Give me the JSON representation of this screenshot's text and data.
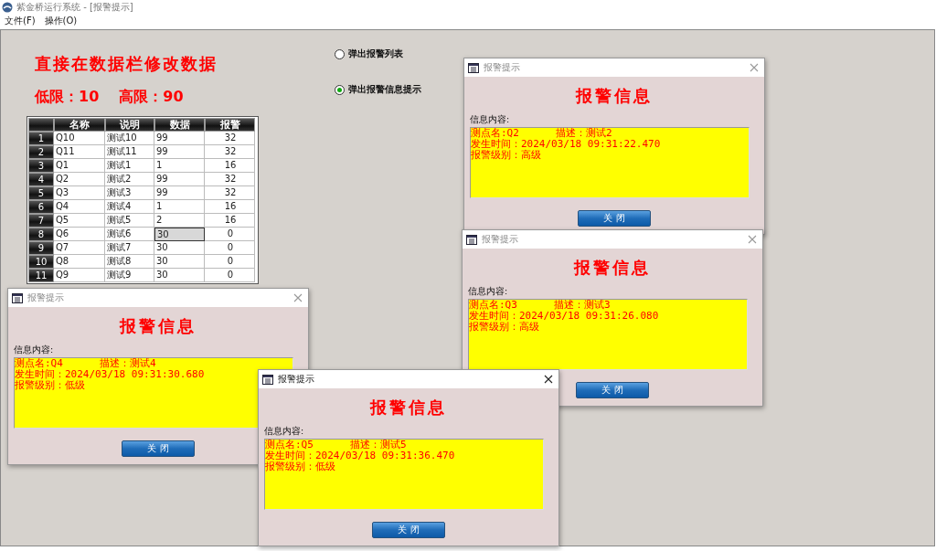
{
  "window": {
    "title": "紫金桥运行系统 - [报警提示]"
  },
  "menu": [
    "文件(F)",
    "操作(O)"
  ],
  "heading": "直接在数据栏修改数据",
  "limits": {
    "low_label": "低限：",
    "low": "10",
    "high_label": "高限：",
    "high": "90"
  },
  "table": {
    "columns": [
      "名称",
      "说明",
      "数据",
      "报警"
    ],
    "rows": [
      {
        "index": "1",
        "name": "Q10",
        "desc": "测试10",
        "data": "99",
        "alarm": "32",
        "focused": false
      },
      {
        "index": "2",
        "name": "Q11",
        "desc": "测试11",
        "data": "99",
        "alarm": "32",
        "focused": false
      },
      {
        "index": "3",
        "name": "Q1",
        "desc": "测试1",
        "data": "1",
        "alarm": "16",
        "focused": false
      },
      {
        "index": "4",
        "name": "Q2",
        "desc": "测试2",
        "data": "99",
        "alarm": "32",
        "focused": false
      },
      {
        "index": "5",
        "name": "Q3",
        "desc": "测试3",
        "data": "99",
        "alarm": "32",
        "focused": false
      },
      {
        "index": "6",
        "name": "Q4",
        "desc": "测试4",
        "data": "1",
        "alarm": "16",
        "focused": false
      },
      {
        "index": "7",
        "name": "Q5",
        "desc": "测试5",
        "data": "2",
        "alarm": "16",
        "focused": false
      },
      {
        "index": "8",
        "name": "Q6",
        "desc": "测试6",
        "data": "30",
        "alarm": "0",
        "focused": true
      },
      {
        "index": "9",
        "name": "Q7",
        "desc": "测试7",
        "data": "30",
        "alarm": "0",
        "focused": false
      },
      {
        "index": "10",
        "name": "Q8",
        "desc": "测试8",
        "data": "30",
        "alarm": "0",
        "focused": false
      },
      {
        "index": "11",
        "name": "Q9",
        "desc": "测试9",
        "data": "30",
        "alarm": "0",
        "focused": false
      }
    ]
  },
  "radios": [
    {
      "label": "弹出报警列表",
      "selected": false
    },
    {
      "label": "弹出报警信息提示",
      "selected": true
    }
  ],
  "dialogs": [
    {
      "title": "报警提示",
      "heading": "报警信息",
      "content_label": "信息内容:",
      "point": "测点名:Q2",
      "desc": "描述：测试2",
      "time": "发生时间：2024/03/18 09:31:22.470",
      "level": "报警级别：高级",
      "button": "关 闭"
    },
    {
      "title": "报警提示",
      "heading": "报警信息",
      "content_label": "信息内容:",
      "point": "测点名:Q4",
      "desc": "描述：测试4",
      "time": "发生时间：2024/03/18 09:31:30.680",
      "level": "报警级别：低级",
      "button": "关 闭"
    },
    {
      "title": "报警提示",
      "heading": "报警信息",
      "content_label": "信息内容:",
      "point": "测点名:Q3",
      "desc": "描述：测试3",
      "time": "发生时间：2024/03/18 09:31:26.080",
      "level": "报警级别：高级",
      "button": "关 闭"
    },
    {
      "title": "报警提示",
      "heading": "报警信息",
      "content_label": "信息内容:",
      "point": "测点名:Q5",
      "desc": "描述：测试5",
      "time": "发生时间：2024/03/18 09:31:36.470",
      "level": "报警级别：低级",
      "button": "关 闭"
    }
  ]
}
